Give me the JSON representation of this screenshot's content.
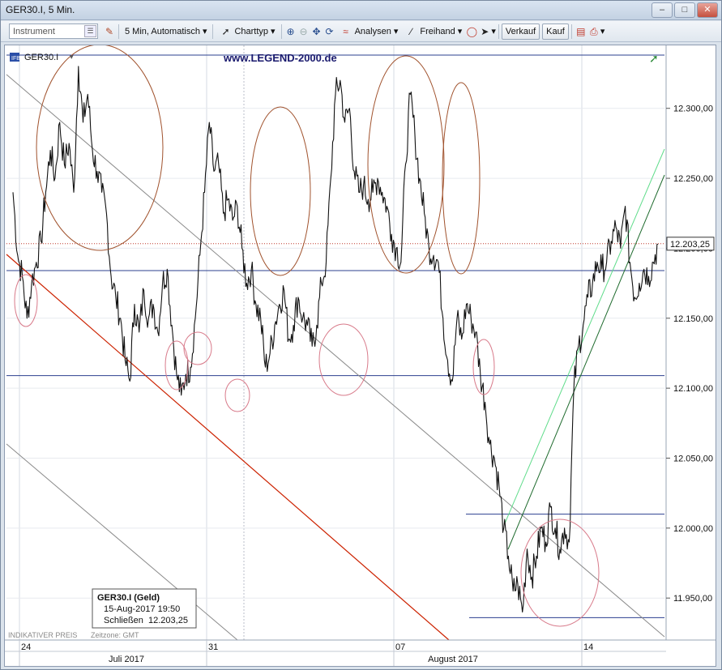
{
  "window": {
    "title": "GER30.I, 5 Min."
  },
  "toolbar": {
    "instrument_placeholder": "Instrument",
    "interval_label": "5 Min, Automatisch",
    "charttype_label": "Charttyp",
    "analysen_label": "Analysen",
    "freihand_label": "Freihand",
    "verkauf_label": "Verkauf",
    "kauf_label": "Kauf"
  },
  "chart_data": {
    "type": "line",
    "symbol": "GER30.I",
    "watermark": "www.LEGEND-2000.de",
    "ylim": [
      11920,
      12345
    ],
    "y_ticks": [
      {
        "value": 11950,
        "label": "11.950,00"
      },
      {
        "value": 12000,
        "label": "12.000,00"
      },
      {
        "value": 12050,
        "label": "12.050,00"
      },
      {
        "value": 12100,
        "label": "12.100,00"
      },
      {
        "value": 12150,
        "label": "12.150,00"
      },
      {
        "value": 12200,
        "label": "12.200,00"
      },
      {
        "value": 12250,
        "label": "12.250,00"
      },
      {
        "value": 12300,
        "label": "12.300,00"
      }
    ],
    "x_day_ticks": [
      "24",
      "31",
      "07",
      "14"
    ],
    "x_month_labels": [
      "Juli 2017",
      "August 2017"
    ],
    "last_price_label": "12.203,25",
    "last_price": 12203.25,
    "grid": true,
    "series": [
      {
        "values": [
          12240,
          12195,
          12180,
          12150,
          12175,
          12190,
          12205,
          12240,
          12270,
          12250,
          12290,
          12260,
          12275,
          12240,
          12330,
          12290,
          12310,
          12270,
          12255,
          12240,
          12225,
          12180,
          12165,
          12150,
          12120,
          12105,
          12160,
          12140,
          12170,
          12150,
          12160,
          12140,
          12175,
          12185,
          12145,
          12110,
          12095,
          12110,
          12115,
          12150,
          12195,
          12240,
          12290,
          12255,
          12260,
          12225,
          12235,
          12220,
          12230,
          12200,
          12175,
          12185,
          12160,
          12150,
          12115,
          12125,
          12145,
          12160,
          12170,
          12135,
          12145,
          12165,
          12150,
          12145,
          12130,
          12145,
          12175,
          12190,
          12250,
          12310,
          12320,
          12290,
          12300,
          12255,
          12240,
          12245,
          12235,
          12240,
          12250,
          12240,
          12230,
          12210,
          12200,
          12190,
          12260,
          12310,
          12280,
          12250,
          12225,
          12200,
          12195,
          12190,
          12150,
          12120,
          12105,
          12150,
          12135,
          12160,
          12150,
          12140,
          12110,
          12090,
          12060,
          12050,
          12030,
          12000,
          11980,
          11955,
          11960,
          11940,
          11985,
          11965,
          11980,
          12000,
          11990,
          12015,
          12000,
          11985,
          12000,
          11990,
          12100,
          12130,
          12145,
          12165,
          12175,
          12190,
          12185,
          12190,
          12205,
          12215,
          12200,
          12230,
          12190,
          12165,
          12175,
          12185,
          12180,
          12190,
          12203
        ]
      }
    ]
  },
  "info_box": {
    "title": "GER30.I (Geld)",
    "datetime": "15-Aug-2017 19:50",
    "close_label": "Schließen",
    "close_value": "12.203,25"
  },
  "footer": {
    "indicative": "INDIKATIVER PREIS",
    "timezone": "Zeitzone: GMT"
  },
  "colors": {
    "price_line": "#111111",
    "red_trend": "#cc2200",
    "grey_trend": "#8a8a8a",
    "h_lines": "#2b3f8f",
    "green_channel": "#1f6b2e",
    "light_green_channel": "#5fdc8a",
    "circles_brown": "#a0522d",
    "circles_pink": "#d87a8a"
  }
}
